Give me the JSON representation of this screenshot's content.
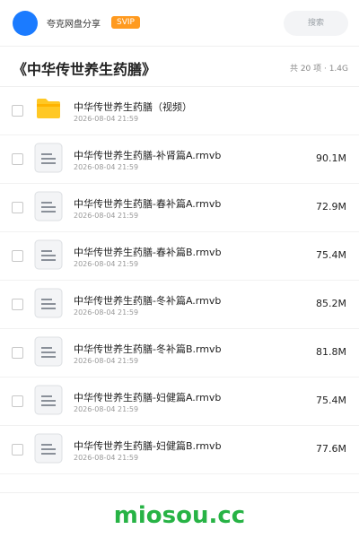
{
  "header": {
    "brand": "夸克网盘分享",
    "badge": "SVIP",
    "search_placeholder": "搜索"
  },
  "folder": {
    "title": "《中华传世养生药膳》",
    "summary": "共 20 项 · 1.4G"
  },
  "items": [
    {
      "name": "中华传世养生药膳（视频）",
      "date": "2026-08-04 21:59",
      "size": "",
      "type": "folder-icon"
    },
    {
      "name": "中华传世养生药膳-补肾篇A.rmvb",
      "date": "2026-08-04 21:59",
      "size": "90.1M",
      "type": "file-icon"
    },
    {
      "name": "中华传世养生药膳-春补篇A.rmvb",
      "date": "2026-08-04 21:59",
      "size": "72.9M",
      "type": "file-icon"
    },
    {
      "name": "中华传世养生药膳-春补篇B.rmvb",
      "date": "2026-08-04 21:59",
      "size": "75.4M",
      "type": "file-icon"
    },
    {
      "name": "中华传世养生药膳-冬补篇A.rmvb",
      "date": "2026-08-04 21:59",
      "size": "85.2M",
      "type": "file-icon"
    },
    {
      "name": "中华传世养生药膳-冬补篇B.rmvb",
      "date": "2026-08-04 21:59",
      "size": "81.8M",
      "type": "file-icon"
    },
    {
      "name": "中华传世养生药膳-妇健篇A.rmvb",
      "date": "2026-08-04 21:59",
      "size": "75.4M",
      "type": "file-icon"
    },
    {
      "name": "中华传世养生药膳-妇健篇B.rmvb",
      "date": "2026-08-04 21:59",
      "size": "77.6M",
      "type": "file-icon"
    }
  ],
  "watermark": "miosou.cc",
  "colors": {
    "accent": "#1b7bff",
    "badge": "#ff9a1f",
    "folder": "#ffc825",
    "watermark": "#27b345"
  }
}
